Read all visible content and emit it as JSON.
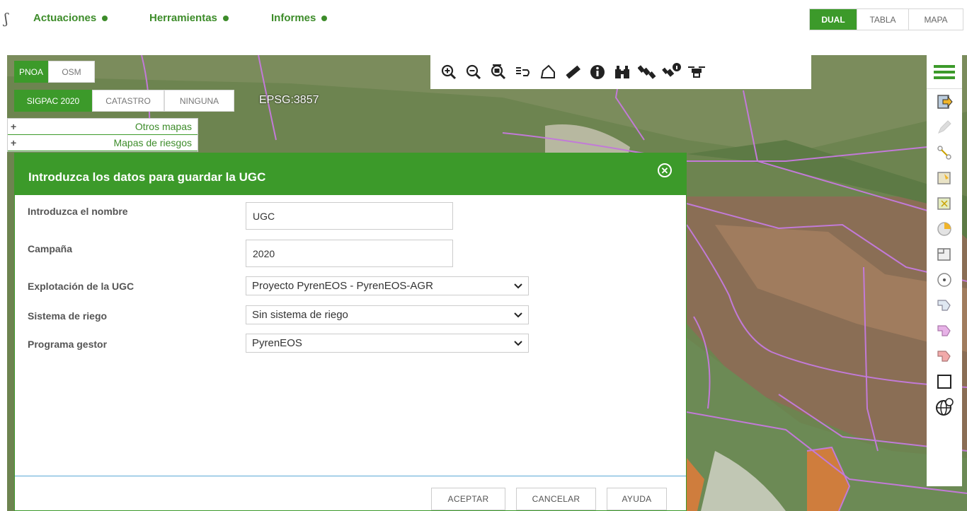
{
  "header": {
    "menu": [
      {
        "label": "Actuaciones"
      },
      {
        "label": "Herramientas"
      },
      {
        "label": "Informes"
      }
    ],
    "view_modes": [
      {
        "label": "DUAL",
        "active": true
      },
      {
        "label": "TABLA",
        "active": false
      },
      {
        "label": "MAPA",
        "active": false
      }
    ]
  },
  "map": {
    "base_layers": [
      {
        "label": "PNOA",
        "active": true
      },
      {
        "label": "OSM",
        "active": false
      }
    ],
    "overlays": [
      {
        "label": "SIGPAC 2020",
        "active": true
      },
      {
        "label": "CATASTRO",
        "active": false
      },
      {
        "label": "NINGUNA",
        "active": false
      }
    ],
    "projection": "EPSG:3857",
    "layer_panel": [
      {
        "icon": "+",
        "label": "Otros mapas"
      },
      {
        "icon": "+",
        "label": "Mapas de riesgos"
      }
    ],
    "toolbar_icons": [
      "zoom-in-icon",
      "zoom-out-icon",
      "zoom-extent-icon",
      "layers-query-icon",
      "polygon-icon",
      "ruler-icon",
      "info-icon",
      "binoculars-icon",
      "satellite-icon",
      "satellite-info-icon",
      "drone-icon"
    ],
    "side_tools": [
      "menu-icon",
      "export-icon",
      "edit-pencil-icon",
      "cut-icon",
      "parcel-edit-icon",
      "parcel-add-icon",
      "pie-icon",
      "parcel-split-icon",
      "target-icon",
      "shape-blue-icon",
      "shape-pink-icon",
      "shape-red-icon",
      "square-icon",
      "globe-icon"
    ]
  },
  "dialog": {
    "title": "Introduzca los datos para guardar la UGC",
    "fields": {
      "name": {
        "label": "Introduzca el nombre",
        "value": "UGC"
      },
      "campaign": {
        "label": "Campaña",
        "value": "2020"
      },
      "exploitation": {
        "label": "Explotación de la UGC",
        "value": "Proyecto PyrenEOS - PyrenEOS-AGR"
      },
      "irrigation": {
        "label": "Sistema de riego",
        "value": "Sin sistema de riego"
      },
      "manager": {
        "label": "Programa gestor",
        "value": "PyrenEOS"
      }
    },
    "buttons": {
      "accept": "ACEPTAR",
      "cancel": "CANCELAR",
      "help": "AYUDA"
    }
  },
  "colors": {
    "primary_green": "#3c9a2a",
    "parcel_outline": "#c27ad8",
    "parcel_fill": "#e07a3a"
  }
}
